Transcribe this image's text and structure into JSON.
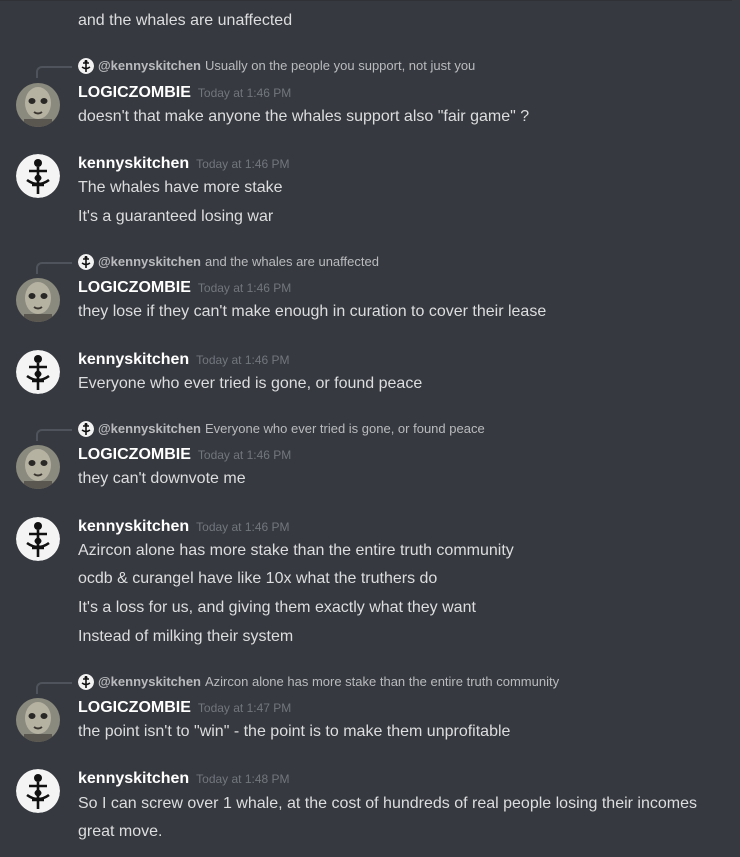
{
  "authors": {
    "logic": "LOGICZOMBIE",
    "kenny": "kennyskitchen"
  },
  "top_line": "and the whales are unaffected",
  "messages": [
    {
      "reply_name": "@kennyskitchen",
      "reply_text": "Usually on the people you support, not just you",
      "author": "LOGICZOMBIE",
      "time": "Today at 1:46 PM",
      "lines": [
        "doesn't that make anyone the whales support also \"fair game\" ?"
      ]
    },
    {
      "author": "kennyskitchen",
      "time": "Today at 1:46 PM",
      "lines": [
        "The whales have more stake",
        "It's a guaranteed losing war"
      ]
    },
    {
      "reply_name": "@kennyskitchen",
      "reply_text": "and the whales are unaffected",
      "author": "LOGICZOMBIE",
      "time": "Today at 1:46 PM",
      "lines": [
        "they lose if they can't make enough in curation to cover their lease"
      ]
    },
    {
      "author": "kennyskitchen",
      "time": "Today at 1:46 PM",
      "lines": [
        "Everyone who ever tried is gone, or found peace"
      ]
    },
    {
      "reply_name": "@kennyskitchen",
      "reply_text": "Everyone who ever tried is gone, or found peace",
      "author": "LOGICZOMBIE",
      "time": "Today at 1:46 PM",
      "lines": [
        "they can't downvote me"
      ]
    },
    {
      "author": "kennyskitchen",
      "time": "Today at 1:46 PM",
      "lines": [
        "Azircon alone has more stake than the entire truth community",
        "ocdb & curangel have like 10x what the truthers do",
        "It's a loss for us, and giving them exactly what they want",
        "Instead of milking their system"
      ]
    },
    {
      "reply_name": "@kennyskitchen",
      "reply_text": "Azircon alone has more stake than the entire truth community",
      "author": "LOGICZOMBIE",
      "time": "Today at 1:47 PM",
      "lines": [
        "the point isn't to \"win\" - the point is to make them unprofitable"
      ]
    },
    {
      "author": "kennyskitchen",
      "time": "Today at 1:48 PM",
      "lines": [
        "So I can screw over 1 whale, at the cost of hundreds of real people losing their incomes",
        "great move."
      ]
    }
  ]
}
